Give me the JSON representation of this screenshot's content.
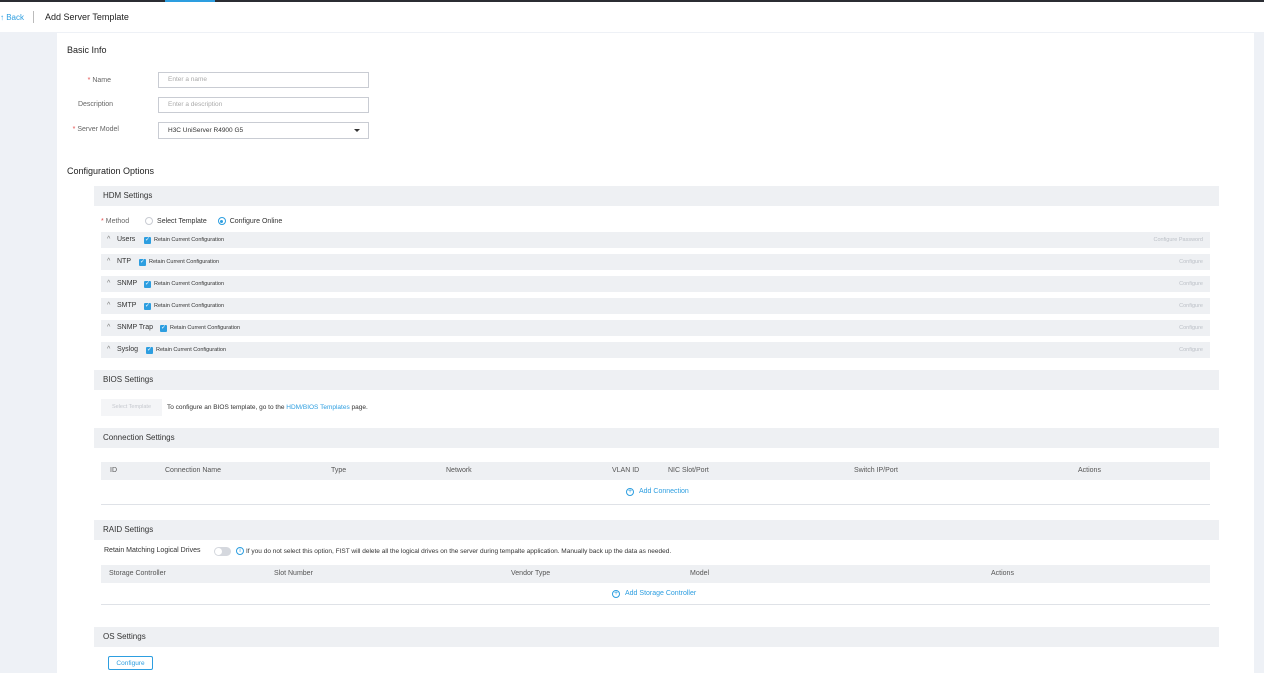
{
  "header": {
    "back_label": "↑ Back",
    "title": "Add Server Template"
  },
  "basic_info": {
    "title": "Basic Info",
    "name": {
      "label": "Name",
      "placeholder": "Enter a name"
    },
    "description": {
      "label": "Description",
      "placeholder": "Enter a description"
    },
    "server_model": {
      "label": "Server Model",
      "value": "H3C UniServer R4900 G5"
    }
  },
  "config_options": {
    "title": "Configuration Options"
  },
  "hdm": {
    "title": "HDM Settings",
    "method_label": "Method",
    "option_template": "Select Template",
    "option_online": "Configure Online",
    "retain_label": "Retain Current Configuration",
    "rows": [
      {
        "name": "Users",
        "action": "Configure Password"
      },
      {
        "name": "NTP",
        "action": "Configure"
      },
      {
        "name": "SNMP",
        "action": "Configure"
      },
      {
        "name": "SMTP",
        "action": "Configure"
      },
      {
        "name": "SNMP Trap",
        "action": "Configure"
      },
      {
        "name": "Syslog",
        "action": "Configure"
      }
    ]
  },
  "bios": {
    "title": "BIOS Settings",
    "select_button": "Select Template",
    "text_before": "To configure an BIOS template, go to the",
    "link": "HDM/BIOS Templates",
    "text_after": "page."
  },
  "connection": {
    "title": "Connection Settings",
    "columns": [
      "ID",
      "Connection Name",
      "Type",
      "Network",
      "VLAN ID",
      "NIC Slot/Port",
      "Switch IP/Port",
      "Actions"
    ],
    "add_label": "Add Connection"
  },
  "raid": {
    "title": "RAID Settings",
    "retain_label": "Retain Matching Logical Drives",
    "note": "If you do not select this option, FIST will delete all the logical drives on the server during tempalte application. Manually back up the data as needed.",
    "columns": [
      "Storage Controller",
      "Slot Number",
      "Vendor Type",
      "Model",
      "Actions"
    ],
    "add_label": "Add Storage Controller"
  },
  "os": {
    "title": "OS Settings",
    "configure_label": "Configure"
  },
  "colors": {
    "accent": "#2d9ee0",
    "required": "#e24b4b",
    "header_bg": "#eef0f3"
  }
}
